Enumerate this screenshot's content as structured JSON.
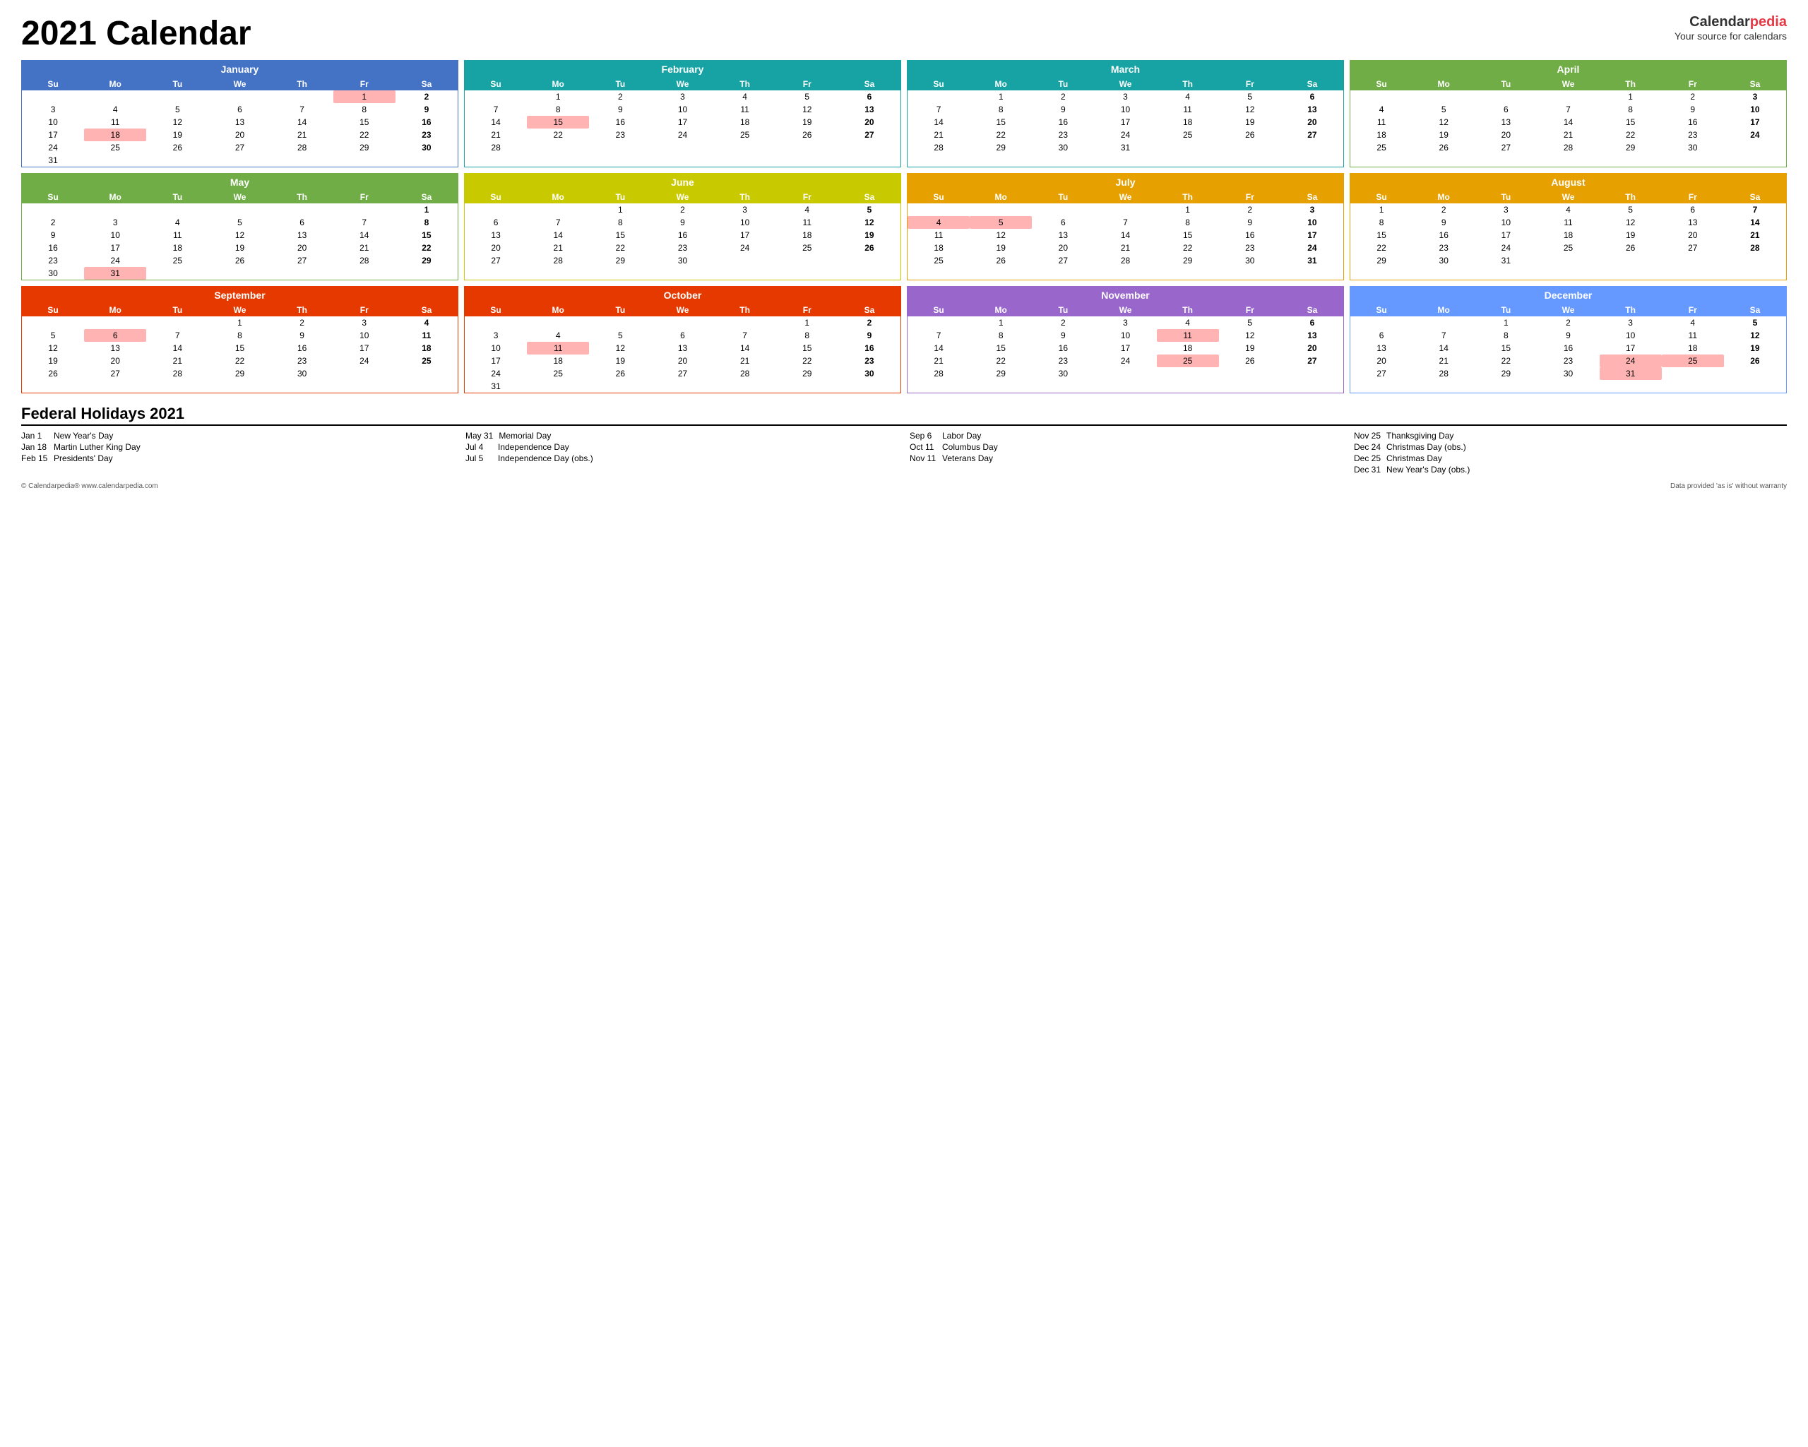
{
  "header": {
    "title": "2021 Calendar",
    "brand_name": "Calendar",
    "brand_accent": "pedia",
    "brand_sub": "Your source for calendars"
  },
  "months": [
    {
      "id": "jan",
      "name": "January",
      "weeks": [
        [
          "",
          "",
          "",
          "",
          "",
          "1",
          "2"
        ],
        [
          "3",
          "4",
          "5",
          "6",
          "7",
          "8",
          "9"
        ],
        [
          "10",
          "11",
          "12",
          "13",
          "14",
          "15",
          "16"
        ],
        [
          "17",
          "18",
          "19",
          "20",
          "21",
          "22",
          "23"
        ],
        [
          "24",
          "25",
          "26",
          "27",
          "28",
          "29",
          "30"
        ],
        [
          "31",
          "",
          "",
          "",
          "",
          "",
          ""
        ]
      ],
      "holidays": {
        "1": true,
        "18": true
      }
    },
    {
      "id": "feb",
      "name": "February",
      "weeks": [
        [
          "",
          "1",
          "2",
          "3",
          "4",
          "5",
          "6"
        ],
        [
          "7",
          "8",
          "9",
          "10",
          "11",
          "12",
          "13"
        ],
        [
          "14",
          "15",
          "16",
          "17",
          "18",
          "19",
          "20"
        ],
        [
          "21",
          "22",
          "23",
          "24",
          "25",
          "26",
          "27"
        ],
        [
          "28",
          "",
          "",
          "",
          "",
          "",
          ""
        ]
      ],
      "holidays": {
        "15": true
      }
    },
    {
      "id": "mar",
      "name": "March",
      "weeks": [
        [
          "",
          "1",
          "2",
          "3",
          "4",
          "5",
          "6"
        ],
        [
          "7",
          "8",
          "9",
          "10",
          "11",
          "12",
          "13"
        ],
        [
          "14",
          "15",
          "16",
          "17",
          "18",
          "19",
          "20"
        ],
        [
          "21",
          "22",
          "23",
          "24",
          "25",
          "26",
          "27"
        ],
        [
          "28",
          "29",
          "30",
          "31",
          "",
          "",
          ""
        ]
      ],
      "holidays": {}
    },
    {
      "id": "apr",
      "name": "April",
      "weeks": [
        [
          "",
          "",
          "",
          "",
          "1",
          "2",
          "3"
        ],
        [
          "4",
          "5",
          "6",
          "7",
          "8",
          "9",
          "10"
        ],
        [
          "11",
          "12",
          "13",
          "14",
          "15",
          "16",
          "17"
        ],
        [
          "18",
          "19",
          "20",
          "21",
          "22",
          "23",
          "24"
        ],
        [
          "25",
          "26",
          "27",
          "28",
          "29",
          "30",
          ""
        ]
      ],
      "holidays": {}
    },
    {
      "id": "may",
      "name": "May",
      "weeks": [
        [
          "",
          "",
          "",
          "",
          "",
          "",
          "1"
        ],
        [
          "2",
          "3",
          "4",
          "5",
          "6",
          "7",
          "8"
        ],
        [
          "9",
          "10",
          "11",
          "12",
          "13",
          "14",
          "15"
        ],
        [
          "16",
          "17",
          "18",
          "19",
          "20",
          "21",
          "22"
        ],
        [
          "23",
          "24",
          "25",
          "26",
          "27",
          "28",
          "29"
        ],
        [
          "30",
          "31",
          "",
          "",
          "",
          "",
          ""
        ]
      ],
      "holidays": {
        "31": true
      }
    },
    {
      "id": "jun",
      "name": "June",
      "weeks": [
        [
          "",
          "",
          "1",
          "2",
          "3",
          "4",
          "5"
        ],
        [
          "6",
          "7",
          "8",
          "9",
          "10",
          "11",
          "12"
        ],
        [
          "13",
          "14",
          "15",
          "16",
          "17",
          "18",
          "19"
        ],
        [
          "20",
          "21",
          "22",
          "23",
          "24",
          "25",
          "26"
        ],
        [
          "27",
          "28",
          "29",
          "30",
          "",
          "",
          ""
        ]
      ],
      "holidays": {}
    },
    {
      "id": "jul",
      "name": "July",
      "weeks": [
        [
          "",
          "",
          "",
          "",
          "1",
          "2",
          "3"
        ],
        [
          "4",
          "5",
          "6",
          "7",
          "8",
          "9",
          "10"
        ],
        [
          "11",
          "12",
          "13",
          "14",
          "15",
          "16",
          "17"
        ],
        [
          "18",
          "19",
          "20",
          "21",
          "22",
          "23",
          "24"
        ],
        [
          "25",
          "26",
          "27",
          "28",
          "29",
          "30",
          "31"
        ]
      ],
      "holidays": {
        "4": true,
        "5": true
      }
    },
    {
      "id": "aug",
      "name": "August",
      "weeks": [
        [
          "1",
          "2",
          "3",
          "4",
          "5",
          "6",
          "7"
        ],
        [
          "8",
          "9",
          "10",
          "11",
          "12",
          "13",
          "14"
        ],
        [
          "15",
          "16",
          "17",
          "18",
          "19",
          "20",
          "21"
        ],
        [
          "22",
          "23",
          "24",
          "25",
          "26",
          "27",
          "28"
        ],
        [
          "29",
          "30",
          "31",
          "",
          "",
          "",
          ""
        ]
      ],
      "holidays": {}
    },
    {
      "id": "sep",
      "name": "September",
      "weeks": [
        [
          "",
          "",
          "",
          "1",
          "2",
          "3",
          "4"
        ],
        [
          "5",
          "6",
          "7",
          "8",
          "9",
          "10",
          "11"
        ],
        [
          "12",
          "13",
          "14",
          "15",
          "16",
          "17",
          "18"
        ],
        [
          "19",
          "20",
          "21",
          "22",
          "23",
          "24",
          "25"
        ],
        [
          "26",
          "27",
          "28",
          "29",
          "30",
          "",
          ""
        ]
      ],
      "holidays": {
        "6": true
      }
    },
    {
      "id": "oct",
      "name": "October",
      "weeks": [
        [
          "",
          "",
          "",
          "",
          "",
          "1",
          "2"
        ],
        [
          "3",
          "4",
          "5",
          "6",
          "7",
          "8",
          "9"
        ],
        [
          "10",
          "11",
          "12",
          "13",
          "14",
          "15",
          "16"
        ],
        [
          "17",
          "18",
          "19",
          "20",
          "21",
          "22",
          "23"
        ],
        [
          "24",
          "25",
          "26",
          "27",
          "28",
          "29",
          "30"
        ],
        [
          "31",
          "",
          "",
          "",
          "",
          "",
          ""
        ]
      ],
      "holidays": {
        "11": true
      }
    },
    {
      "id": "nov",
      "name": "November",
      "weeks": [
        [
          "",
          "1",
          "2",
          "3",
          "4",
          "5",
          "6"
        ],
        [
          "7",
          "8",
          "9",
          "10",
          "11",
          "12",
          "13"
        ],
        [
          "14",
          "15",
          "16",
          "17",
          "18",
          "19",
          "20"
        ],
        [
          "21",
          "22",
          "23",
          "24",
          "25",
          "26",
          "27"
        ],
        [
          "28",
          "29",
          "30",
          "",
          "",
          "",
          ""
        ]
      ],
      "holidays": {
        "11": true,
        "25": true
      }
    },
    {
      "id": "dec",
      "name": "December",
      "weeks": [
        [
          "",
          "",
          "1",
          "2",
          "3",
          "4",
          "5"
        ],
        [
          "6",
          "7",
          "8",
          "9",
          "10",
          "11",
          "12"
        ],
        [
          "13",
          "14",
          "15",
          "16",
          "17",
          "18",
          "19"
        ],
        [
          "20",
          "21",
          "22",
          "23",
          "24",
          "25",
          "26"
        ],
        [
          "27",
          "28",
          "29",
          "30",
          "31",
          "",
          ""
        ]
      ],
      "holidays": {
        "24": true,
        "25": true,
        "31": true
      }
    }
  ],
  "weekdays": [
    "Su",
    "Mo",
    "Tu",
    "We",
    "Th",
    "Fr",
    "Sa"
  ],
  "holidays_title": "Federal Holidays 2021",
  "holidays_list": [
    [
      {
        "date": "Jan 1",
        "name": "New Year's Day"
      },
      {
        "date": "Jan 18",
        "name": "Martin Luther King Day"
      },
      {
        "date": "Feb 15",
        "name": "Presidents' Day"
      }
    ],
    [
      {
        "date": "May 31",
        "name": "Memorial Day"
      },
      {
        "date": "Jul 4",
        "name": "Independence Day"
      },
      {
        "date": "Jul 5",
        "name": "Independence Day (obs.)"
      }
    ],
    [
      {
        "date": "Sep 6",
        "name": "Labor Day"
      },
      {
        "date": "Oct 11",
        "name": "Columbus Day"
      },
      {
        "date": "Nov 11",
        "name": "Veterans Day"
      }
    ],
    [
      {
        "date": "Nov 25",
        "name": "Thanksgiving Day"
      },
      {
        "date": "Dec 24",
        "name": "Christmas Day (obs.)"
      },
      {
        "date": "Dec 25",
        "name": "Christmas Day"
      },
      {
        "date": "Dec 31",
        "name": "New Year's Day (obs.)"
      }
    ]
  ],
  "footer_left": "© Calendarpedia®   www.calendarpedia.com",
  "footer_right": "Data provided 'as is' without warranty"
}
